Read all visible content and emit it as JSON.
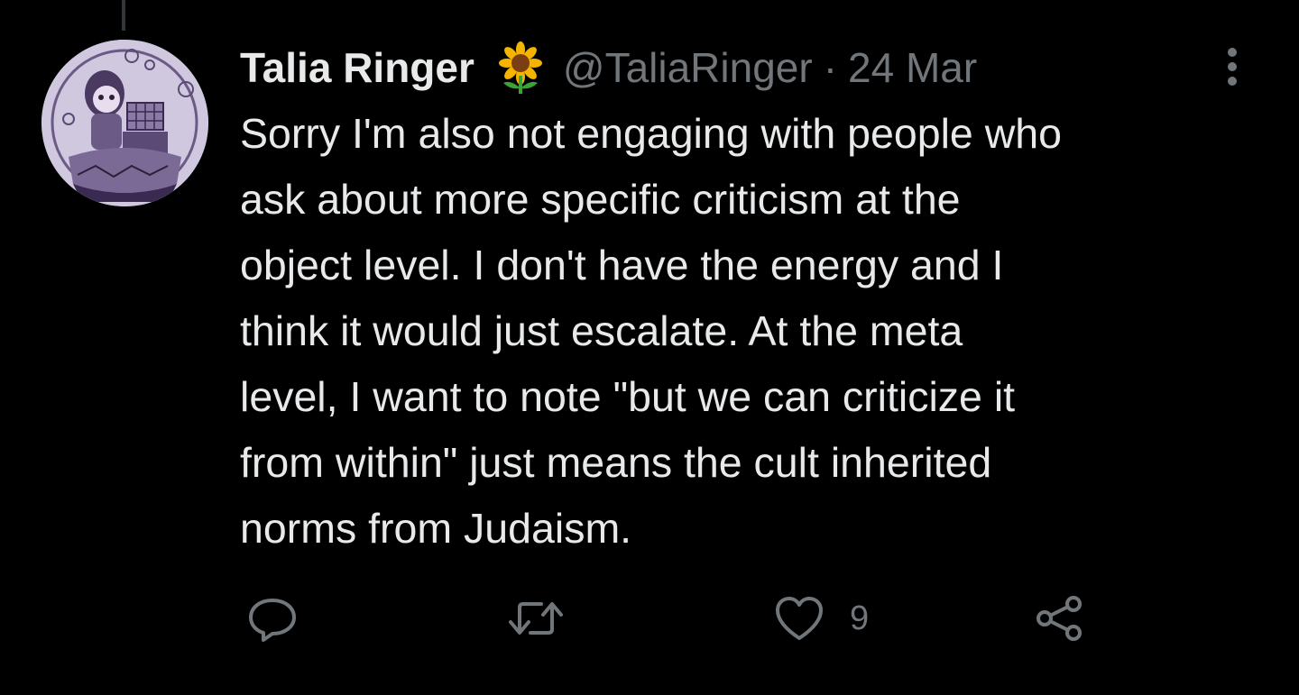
{
  "tweet": {
    "author_name": "Talia Ringer",
    "author_emoji": "sunflower",
    "handle": "@TaliaRinger",
    "separator": "·",
    "date": "24 Mar",
    "text": "Sorry I'm also not engaging with people who\nask about more specific criticism at the\nobject level. I don't have the energy and I\nthink it would just escalate. At the meta\nlevel, I want to note \"but we can criticize it\nfrom within\" just means the cult inherited\nnorms from Judaism."
  },
  "actions": {
    "reply_icon": "reply-bubble",
    "retweet_icon": "retweet-arrows",
    "like_icon": "heart",
    "like_count": "9",
    "share_icon": "share-nodes"
  },
  "colors": {
    "background": "#000000",
    "primary_text": "#e7e9ea",
    "secondary_text": "#71767b",
    "sunflower_petals": "#f4b400",
    "sunflower_center": "#7a3e12",
    "stem": "#3aa335"
  }
}
